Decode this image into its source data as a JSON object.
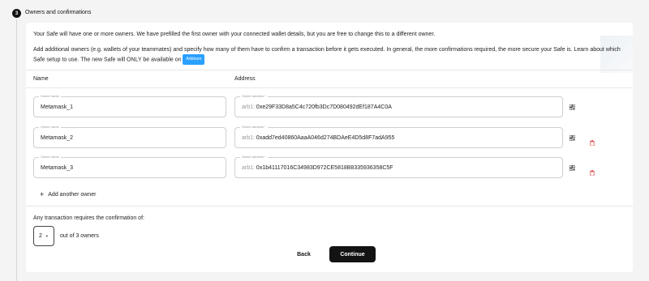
{
  "step": {
    "number": "3",
    "title": "Owners and confirmations"
  },
  "intro": {
    "line1": "Your Safe will have one or more owners. We have prefilled the first owner with your connected wallet details, but you are free to change this to a different owner.",
    "line2": "Add additional owners (e.g. wallets of your teammates) and specify how many of them have to confirm a transaction before it gets executed. In general, the more confirmations required, the more secure your Safe is. Learn about which Safe setup to use. The new Safe will ONLY be available on",
    "network_tag": "Arbitrum"
  },
  "columns": {
    "name": "Name",
    "address": "Address"
  },
  "owners": [
    {
      "name_label": "Owner name",
      "name": "Metamask_1",
      "address_label": "Owner address *",
      "prefix": "arb1:",
      "address": "0xe29F33D8a5C4c720fb3Dc7D080492dEf187A4C0A",
      "removable": false
    },
    {
      "name_label": "Owner name",
      "name": "Metamask_2",
      "address_label": "Owner address *",
      "prefix": "arb1:",
      "address": "0xadd7ed40860AaaA046d274BDAeE4D5d8F7adA955",
      "removable": true
    },
    {
      "name_label": "Owner name",
      "name": "Metamask_3",
      "address_label": "Owner address *",
      "prefix": "arb1:",
      "address": "0x1b41117016C34983D972CE5818B8335936358C5F",
      "removable": true
    }
  ],
  "add_owner": {
    "plus": "+",
    "label": "Add another owner"
  },
  "threshold": {
    "prompt": "Any transaction requires the confirmation of:",
    "value": "2",
    "out_of": "out of 3 owners"
  },
  "buttons": {
    "back": "Back",
    "continue": "Continue"
  },
  "icons": {
    "qr": "qr-code-icon",
    "trash": "trash-icon",
    "caret": "caret-down-icon"
  },
  "colors": {
    "primary": "#121312",
    "tag": "#2aa0ff",
    "trash": "#e05555"
  }
}
